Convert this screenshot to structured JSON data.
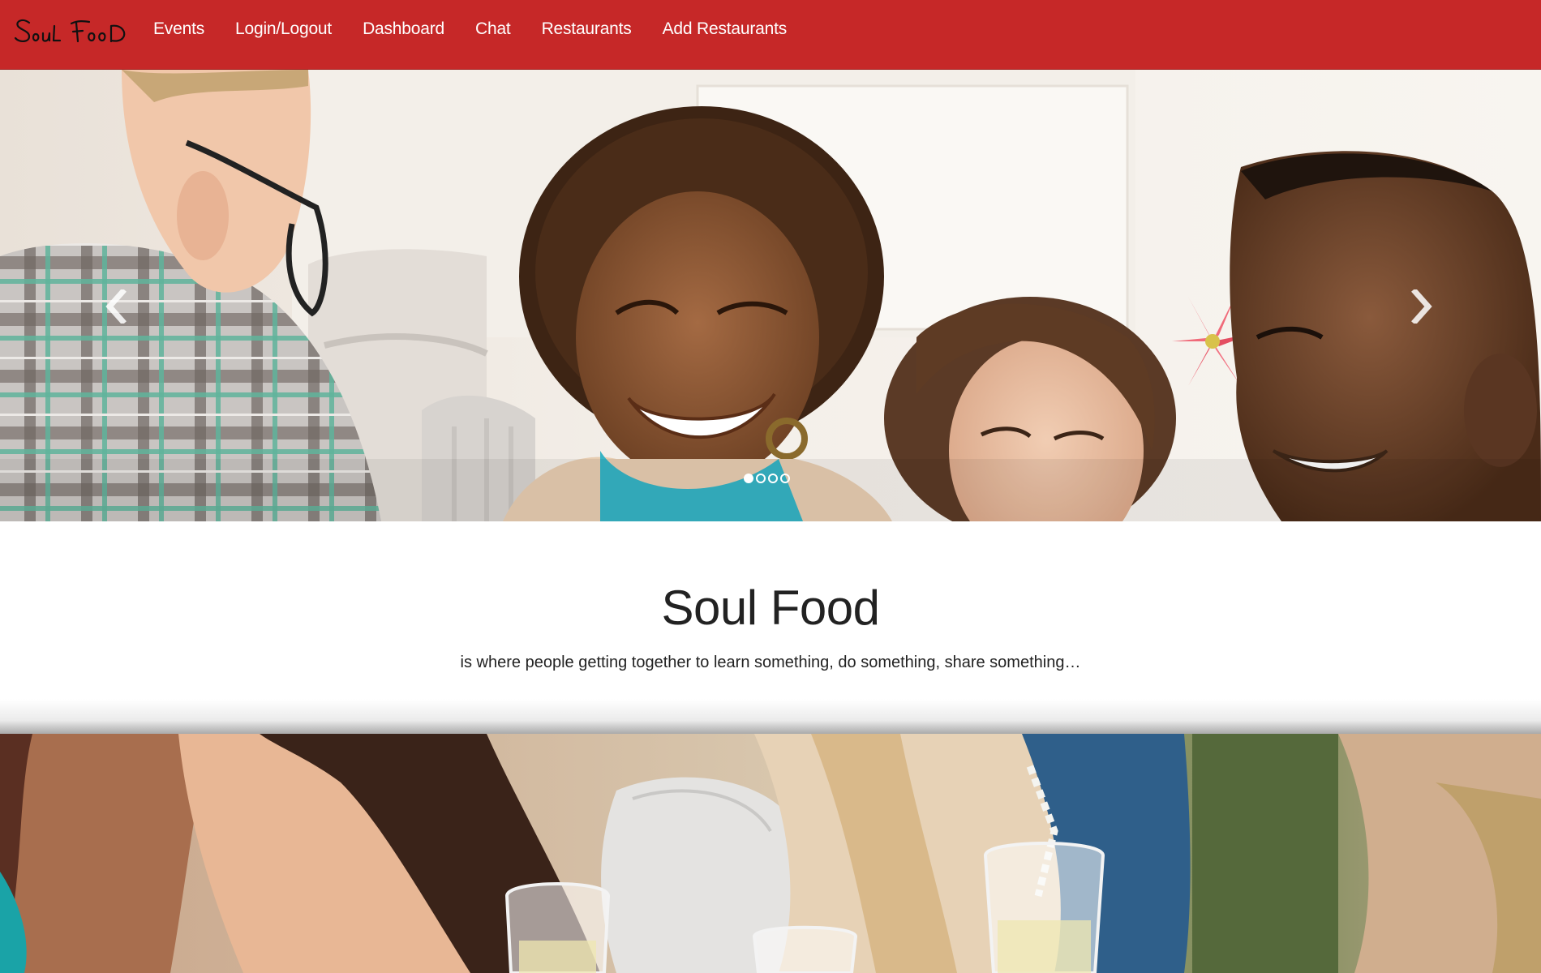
{
  "nav": {
    "brand": "Soul Food",
    "links": [
      {
        "label": "Events"
      },
      {
        "label": "Login/Logout"
      },
      {
        "label": "Dashboard"
      },
      {
        "label": "Chat"
      },
      {
        "label": "Restaurants"
      },
      {
        "label": "Add Restaurants"
      }
    ],
    "background_color": "#c62828"
  },
  "carousel": {
    "prev_icon": "chevron-left-icon",
    "next_icon": "chevron-right-icon",
    "slide_count": 4,
    "active_slide": 1
  },
  "intro": {
    "title": "Soul Food",
    "tagline": "is where people getting together to learn something, do something, share something…"
  }
}
